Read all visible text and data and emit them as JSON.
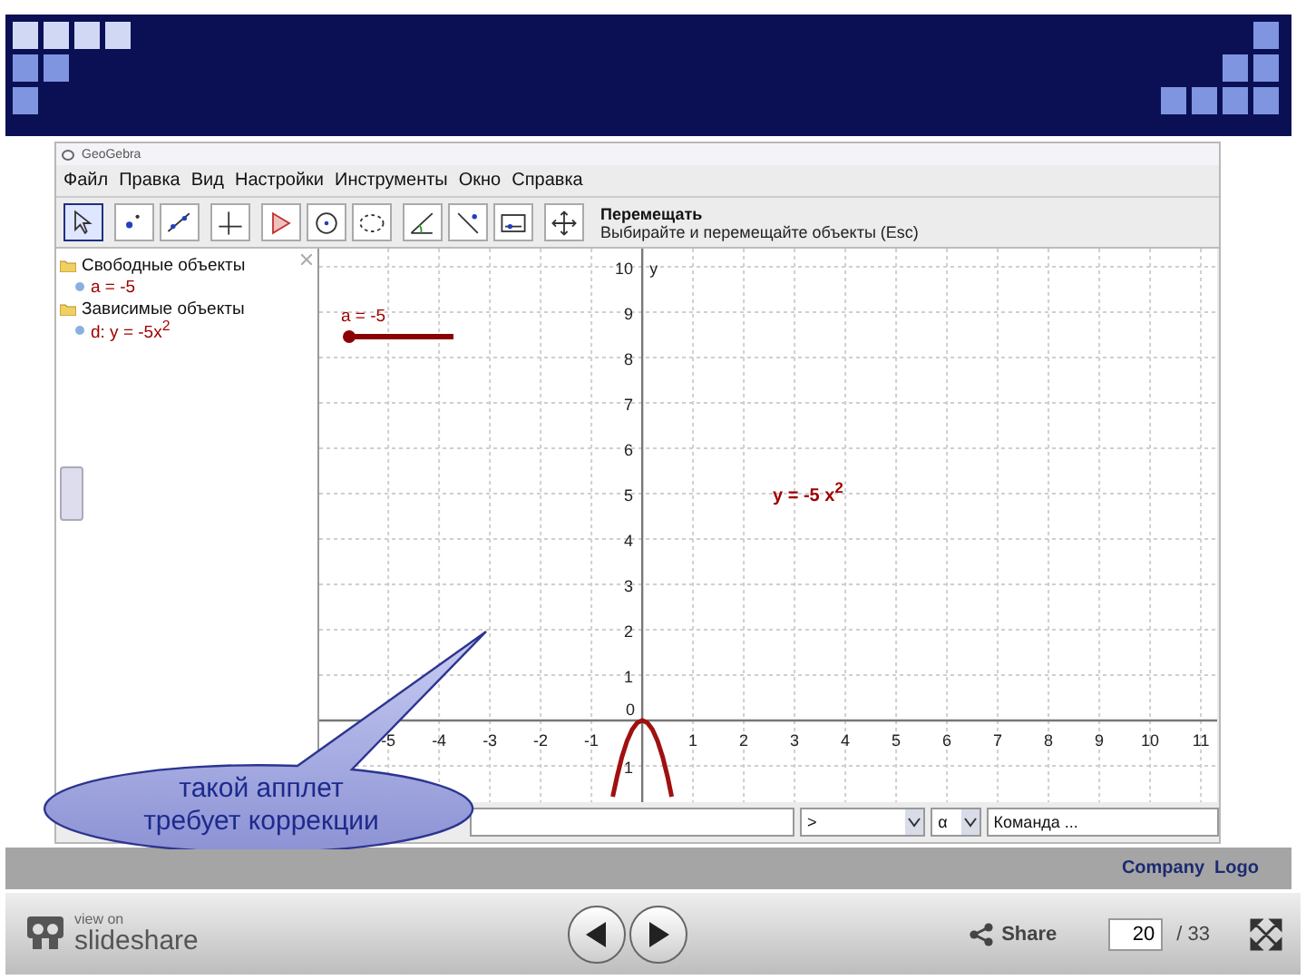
{
  "slide": {
    "app": {
      "title": "GeoGebra",
      "menu": [
        "Файл",
        "Правка",
        "Вид",
        "Настройки",
        "Инструменты",
        "Окно",
        "Справка"
      ],
      "tools": [
        {
          "kind": "pointer",
          "selected": true
        },
        {
          "kind": "point",
          "selected": false
        },
        {
          "kind": "line",
          "selected": false
        },
        {
          "kind": "perpendicular",
          "selected": false
        },
        {
          "kind": "polygon",
          "selected": false
        },
        {
          "kind": "circle",
          "selected": false
        },
        {
          "kind": "conic",
          "selected": false
        },
        {
          "kind": "angle",
          "selected": false
        },
        {
          "kind": "reflect",
          "selected": false
        },
        {
          "kind": "slider",
          "selected": false
        },
        {
          "kind": "move-view",
          "selected": false
        }
      ],
      "tool_info": {
        "name": "Перемещать",
        "hint": "Выбирайте и перемещайте объекты (Esc)"
      },
      "algebra": {
        "groups": [
          {
            "label": "Свободные объекты",
            "children": [
              {
                "label": "a = -5"
              }
            ]
          },
          {
            "label": "Зависимые объекты",
            "children": [
              {
                "label": "d: y = -5x$^{2}$"
              }
            ]
          }
        ]
      },
      "graphics": {
        "slider": {
          "label": "a = -5",
          "level": 0
        },
        "function_label": "y = -5 x$^{2}$",
        "origin_label": "0",
        "axis_label": "y",
        "chart_data": {
          "type": "line",
          "x": [
            -0.58,
            -0.5,
            -0.4,
            -0.3,
            -0.2,
            -0.1,
            0,
            0.1,
            0.2,
            0.3,
            0.4,
            0.5,
            0.58
          ],
          "grid": true,
          "series": [
            {
              "color": "#a01010",
              "values": [
                -1.68,
                -1.25,
                -0.8,
                -0.45,
                -0.2,
                -0.05,
                0,
                -0.05,
                -0.2,
                -0.45,
                -0.8,
                -1.25,
                -1.68
              ]
            }
          ],
          "xlim": [
            -6.36,
            11.32
          ],
          "ylim": [
            -1.8,
            10.4
          ],
          "xticks": [
            -5,
            -4,
            -3,
            -2,
            -1,
            1,
            2,
            3,
            4,
            5,
            6,
            7,
            8,
            9,
            10,
            11
          ],
          "yticks": [
            {
              "value": -1,
              "label": "1"
            },
            1,
            2,
            3,
            4,
            5,
            6,
            7,
            8,
            9,
            10
          ]
        }
      },
      "input_bar": {
        "symbol": ">",
        "greek": "α",
        "command": "Команда ..."
      }
    },
    "callout": [
      "такой апплет",
      "требует коррекции"
    ],
    "footer_logo": "Company  Logo"
  },
  "player": {
    "brand_small": "view on",
    "brand": "slideshare",
    "share": "Share",
    "page": "20",
    "total": "/ 33"
  }
}
